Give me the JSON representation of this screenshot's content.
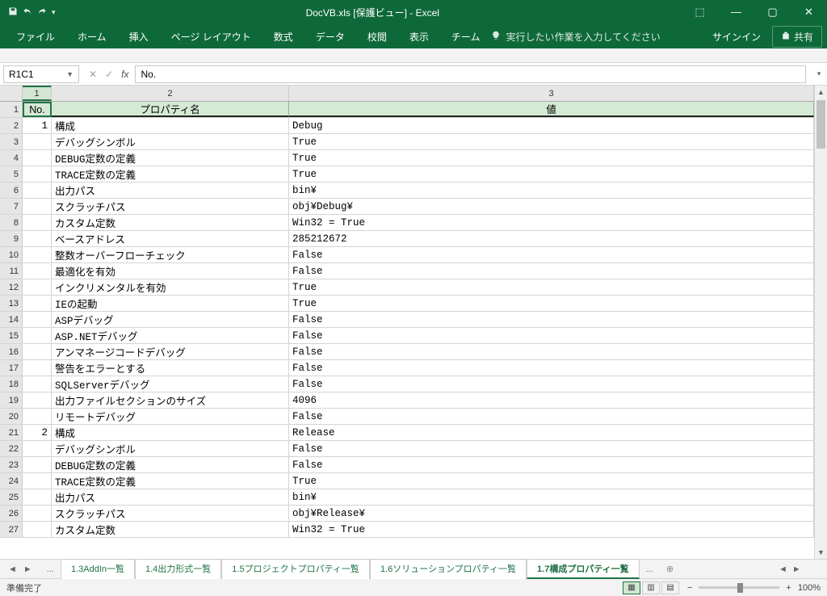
{
  "title": "DocVB.xls  [保護ビュー] - Excel",
  "qat": {
    "save": "save",
    "undo": "undo",
    "redo": "redo"
  },
  "wincontrols": {
    "ribbonopts": "⬚",
    "min": "—",
    "max": "▢",
    "close": "✕"
  },
  "ribbon": {
    "tabs": [
      "ファイル",
      "ホーム",
      "挿入",
      "ページ レイアウト",
      "数式",
      "データ",
      "校閲",
      "表示",
      "チーム"
    ],
    "tell_placeholder": "実行したい作業を入力してください",
    "signin": "サインイン",
    "share": "共有"
  },
  "namebox": "R1C1",
  "formula": "No.",
  "columns": [
    "1",
    "2",
    "3"
  ],
  "header_row": [
    "No.",
    "プロパティ名",
    "値"
  ],
  "rows": [
    {
      "rh": "1",
      "no": "",
      "name": "",
      "val": "",
      "hdr": true
    },
    {
      "rh": "2",
      "no": "1",
      "name": "構成",
      "val": "Debug"
    },
    {
      "rh": "3",
      "no": "",
      "name": "デバッグシンボル",
      "val": "True"
    },
    {
      "rh": "4",
      "no": "",
      "name": "DEBUG定数の定義",
      "val": "True"
    },
    {
      "rh": "5",
      "no": "",
      "name": "TRACE定数の定義",
      "val": "True"
    },
    {
      "rh": "6",
      "no": "",
      "name": "出力パス",
      "val": "bin¥"
    },
    {
      "rh": "7",
      "no": "",
      "name": "スクラッチパス",
      "val": "obj¥Debug¥"
    },
    {
      "rh": "8",
      "no": "",
      "name": "カスタム定数",
      "val": "Win32 = True"
    },
    {
      "rh": "9",
      "no": "",
      "name": "ベースアドレス",
      "val": "285212672"
    },
    {
      "rh": "10",
      "no": "",
      "name": "整数オーバーフローチェック",
      "val": "False"
    },
    {
      "rh": "11",
      "no": "",
      "name": "最適化を有効",
      "val": "False"
    },
    {
      "rh": "12",
      "no": "",
      "name": "インクリメンタルを有効",
      "val": "True"
    },
    {
      "rh": "13",
      "no": "",
      "name": "IEの起動",
      "val": "True"
    },
    {
      "rh": "14",
      "no": "",
      "name": "ASPデバッグ",
      "val": "False"
    },
    {
      "rh": "15",
      "no": "",
      "name": "ASP.NETデバッグ",
      "val": "False"
    },
    {
      "rh": "16",
      "no": "",
      "name": "アンマネージコードデバッグ",
      "val": "False"
    },
    {
      "rh": "17",
      "no": "",
      "name": "警告をエラーとする",
      "val": "False"
    },
    {
      "rh": "18",
      "no": "",
      "name": "SQLServerデバッグ",
      "val": "False"
    },
    {
      "rh": "19",
      "no": "",
      "name": "出力ファイルセクションのサイズ",
      "val": "4096"
    },
    {
      "rh": "20",
      "no": "",
      "name": "リモートデバッグ",
      "val": "False"
    },
    {
      "rh": "21",
      "no": "2",
      "name": "構成",
      "val": "Release"
    },
    {
      "rh": "22",
      "no": "",
      "name": "デバッグシンボル",
      "val": "False"
    },
    {
      "rh": "23",
      "no": "",
      "name": "DEBUG定数の定義",
      "val": "False"
    },
    {
      "rh": "24",
      "no": "",
      "name": "TRACE定数の定義",
      "val": "True"
    },
    {
      "rh": "25",
      "no": "",
      "name": "出力パス",
      "val": "bin¥"
    },
    {
      "rh": "26",
      "no": "",
      "name": "スクラッチパス",
      "val": "obj¥Release¥"
    },
    {
      "rh": "27",
      "no": "",
      "name": "カスタム定数",
      "val": "Win32 = True"
    }
  ],
  "sheet_tabs": {
    "prev_more": "...",
    "tabs": [
      "1.3AddIn一覧",
      "1.4出力形式一覧",
      "1.5プロジェクトプロパティ一覧",
      "1.6ソリューションプロパティ一覧",
      "1.7構成プロパティ一覧"
    ],
    "active_index": 4,
    "next_more": "...",
    "add": "⊕"
  },
  "statusbar": {
    "ready": "準備完了",
    "zoom": "100%"
  }
}
